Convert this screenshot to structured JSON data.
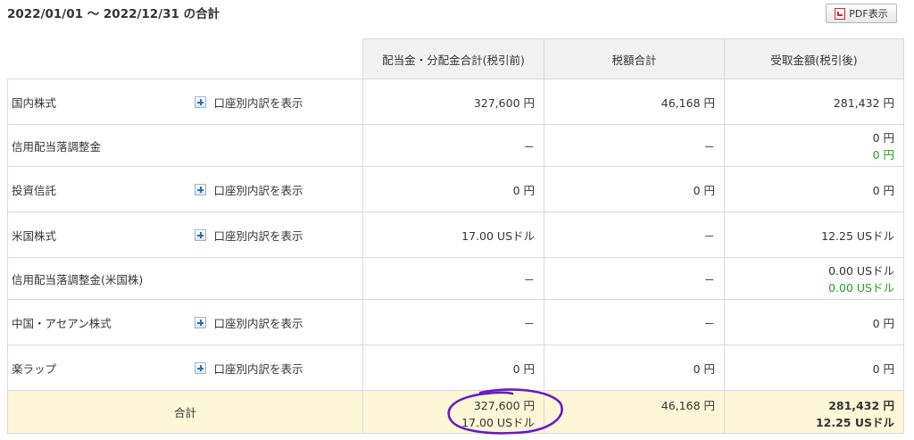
{
  "period": "2022/01/01 ～ 2022/12/31 の合計",
  "pdf_button": "PDF表示",
  "headers": {
    "dividends": "配当金・分配金合計(税引前)",
    "tax": "税額合計",
    "received": "受取金額(税引後)"
  },
  "breakdown_label": "口座別内訳を表示",
  "rows": [
    {
      "label": "国内株式",
      "dividends": "327,600 円",
      "tax": "46,168 円",
      "received": "281,432 円",
      "received2": ""
    },
    {
      "label": "信用配当落調整金",
      "dividends": "－",
      "tax": "－",
      "received": "0 円",
      "received2": "0 円"
    },
    {
      "label": "投資信託",
      "dividends": "0 円",
      "tax": "0 円",
      "received": "0 円",
      "received2": ""
    },
    {
      "label": "米国株式",
      "dividends": "17.00 USドル",
      "tax": "－",
      "received": "12.25 USドル",
      "received2": ""
    },
    {
      "label": "信用配当落調整金(米国株)",
      "dividends": "－",
      "tax": "－",
      "received": "0.00 USドル",
      "received2": "0.00 USドル"
    },
    {
      "label": "中国・アセアン株式",
      "dividends": "－",
      "tax": "－",
      "received": "0 円",
      "received2": ""
    },
    {
      "label": "楽ラップ",
      "dividends": "0 円",
      "tax": "0 円",
      "received": "0 円",
      "received2": ""
    }
  ],
  "total": {
    "label": "合計",
    "dividends_jpy": "327,600 円",
    "dividends_usd": "17.00 USドル",
    "tax": "46,168 円",
    "received_jpy": "281,432 円",
    "received_usd": "12.25 USドル"
  },
  "annotation_color": "#6a1bc4"
}
